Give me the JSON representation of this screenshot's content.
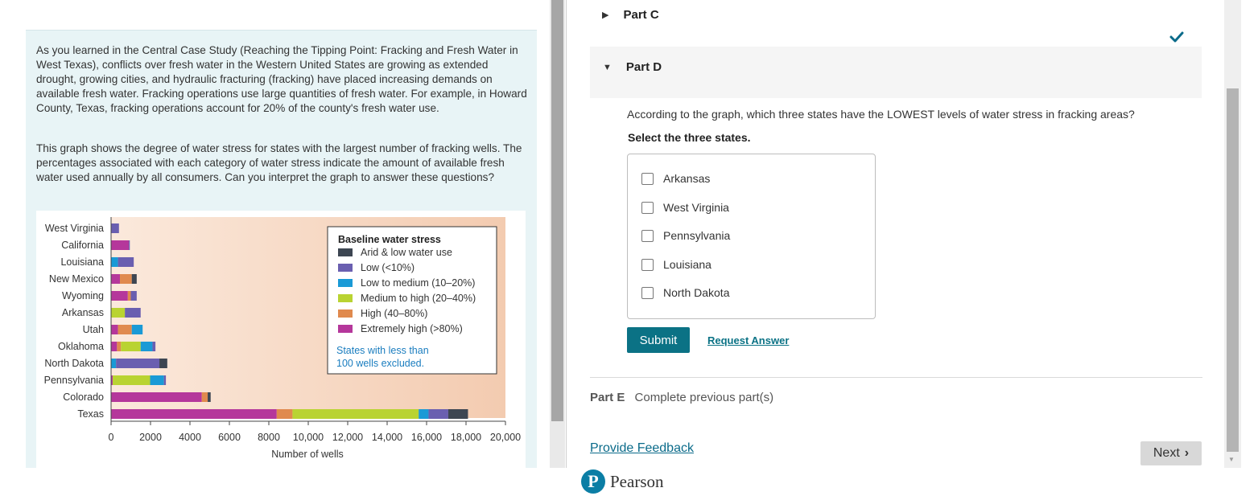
{
  "left_panel": {
    "paragraph1": "As you learned in the Central Case Study (Reaching the Tipping Point: Fracking and Fresh Water in West Texas), conflicts over fresh water in the Western United States are growing as extended drought, growing cities, and hydraulic fracturing (fracking) have placed increasing demands on available fresh water. Fracking operations use large quantities of fresh water. For example, in Howard County, Texas, fracking operations account for 20% of the county's fresh water use.",
    "paragraph2": "This graph shows the degree of water stress for states with the largest number of fracking wells. The percentages associated with each category of water stress indicate the amount of available fresh water used annually by all consumers. Can you interpret the graph to answer these questions?"
  },
  "chart_data": {
    "type": "bar",
    "orientation": "horizontal",
    "stacked": true,
    "categories": [
      "West Virginia",
      "California",
      "Louisiana",
      "New Mexico",
      "Wyoming",
      "Arkansas",
      "Utah",
      "Oklahoma",
      "North Dakota",
      "Pennsylvania",
      "Colorado",
      "Texas"
    ],
    "series": [
      {
        "name": "Extremely high (>80%)",
        "color": "#b5379b",
        "values": [
          0,
          900,
          0,
          450,
          850,
          0,
          350,
          300,
          0,
          80,
          4600,
          8400
        ]
      },
      {
        "name": "High (40–80%)",
        "color": "#e08a4e",
        "values": [
          0,
          0,
          0,
          600,
          150,
          0,
          700,
          200,
          0,
          0,
          300,
          800
        ]
      },
      {
        "name": "Medium to high (20–40%)",
        "color": "#b9d332",
        "values": [
          0,
          0,
          0,
          0,
          0,
          700,
          0,
          1000,
          0,
          1900,
          0,
          6400
        ]
      },
      {
        "name": "Low to medium (10–20%)",
        "color": "#1a9ad6",
        "values": [
          0,
          0,
          350,
          0,
          0,
          0,
          550,
          600,
          250,
          700,
          0,
          500
        ]
      },
      {
        "name": "Low (<10%)",
        "color": "#6a5fb0",
        "values": [
          400,
          50,
          800,
          0,
          300,
          800,
          0,
          150,
          2200,
          100,
          0,
          1000
        ]
      },
      {
        "name": "Arid & low water use",
        "color": "#3d4652",
        "values": [
          0,
          0,
          0,
          250,
          0,
          0,
          0,
          0,
          400,
          0,
          150,
          1000
        ]
      }
    ],
    "legend_order": [
      "Arid & low water use",
      "Low (<10%)",
      "Low to medium (10–20%)",
      "Medium to high (20–40%)",
      "High (40–80%)",
      "Extremely high (>80%)"
    ],
    "legend_title": "Baseline water stress",
    "legend_note_line1": "States with less than",
    "legend_note_line2": "100 wells excluded.",
    "xlabel": "Number of wells",
    "xlim": [
      0,
      20000
    ],
    "xticks": [
      0,
      2000,
      4000,
      6000,
      8000,
      10000,
      12000,
      14000,
      16000,
      18000,
      20000
    ],
    "xtick_labels": [
      "0",
      "2000",
      "4000",
      "6000",
      "8000",
      "10,000",
      "12,000",
      "14,000",
      "16,000",
      "18,000",
      "20,000"
    ],
    "legend_position": "top-right",
    "grid": false
  },
  "right_panel": {
    "part_c": "Part C",
    "part_d": "Part D",
    "question": "According to the graph, which three states have the LOWEST levels of water stress in fracking areas?",
    "instruction": "Select the three states.",
    "options": [
      "Arkansas",
      "West Virginia",
      "Pennsylvania",
      "Louisiana",
      "North Dakota"
    ],
    "submit": "Submit",
    "request_answer": "Request Answer",
    "part_e_label": "Part E",
    "part_e_status": "Complete previous part(s)",
    "feedback": "Provide Feedback",
    "next": "Next",
    "brand": "Pearson",
    "brand_letter": "P"
  }
}
